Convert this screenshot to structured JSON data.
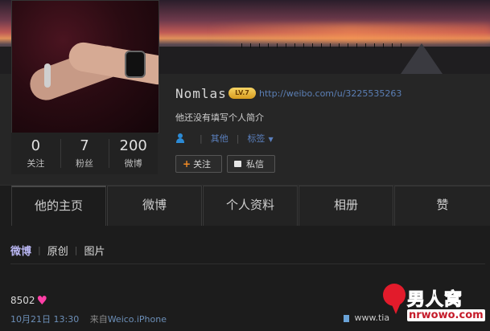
{
  "profile": {
    "name": "Nomlas",
    "level_badge": "LV.7",
    "url": "http://weibo.com/u/3225535263",
    "bio": "他还没有填写个人简介",
    "other_label": "其他",
    "tags_label": "标签",
    "stats": [
      {
        "value": "0",
        "label": "关注"
      },
      {
        "value": "7",
        "label": "粉丝"
      },
      {
        "value": "200",
        "label": "微博"
      }
    ],
    "follow_label": "关注",
    "message_label": "私信"
  },
  "tabs": [
    "他的主页",
    "微博",
    "个人资料",
    "相册",
    "赞"
  ],
  "subnav": [
    "微博",
    "原创",
    "图片"
  ],
  "post": {
    "text": "8502",
    "time": "10月21日 13:30",
    "source_prefix": "来自",
    "source": "Weico.iPhone",
    "action_text": "www.tia"
  },
  "watermark": {
    "title": "男人窝",
    "url": "nrwowo.com"
  },
  "colors": {
    "page_bg": "#1e1e1e",
    "link": "#5b7fb5",
    "accent_plus": "#f08a24",
    "heart": "#ff3fa6"
  }
}
